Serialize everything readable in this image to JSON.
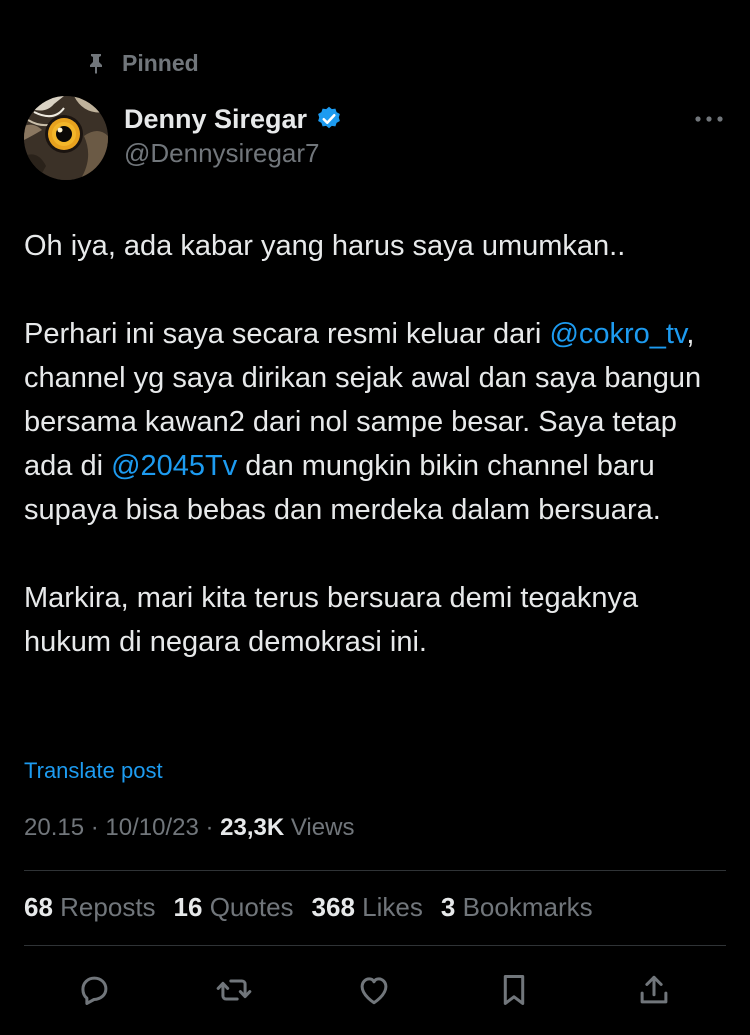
{
  "pinned": {
    "label": "Pinned",
    "icon": "pin-icon"
  },
  "author": {
    "name": "Denny Siregar",
    "handle": "@Dennysiregar7",
    "verified": true,
    "avatar_icon": "owl-eye-avatar"
  },
  "more_icon": "more-horizontal-icon",
  "tweet": {
    "line1": "Oh iya, ada kabar yang harus saya umumkan..",
    "p2_before": "Perhari ini saya secara resmi keluar dari ",
    "mention1": "@cokro_tv",
    "p2_middle": ", channel yg saya dirikan sejak awal dan saya bangun bersama kawan2 dari nol sampe besar. Saya tetap ada di ",
    "mention2": "@2045Tv",
    "p2_after": " dan mungkin bikin channel baru supaya bisa bebas dan merdeka dalam bersuara.",
    "p3": "Markira, mari kita terus bersuara demi tegaknya hukum di negara demokrasi ini."
  },
  "translate_label": "Translate post",
  "meta": {
    "time": "20.15",
    "separator": " · ",
    "date": "10/10/23",
    "views_count": "23,3K",
    "views_label": " Views"
  },
  "stats": [
    {
      "count": "68",
      "label": "Reposts"
    },
    {
      "count": "16",
      "label": "Quotes"
    },
    {
      "count": "368",
      "label": "Likes"
    },
    {
      "count": "3",
      "label": "Bookmarks"
    }
  ],
  "actions": [
    "reply-icon",
    "repost-icon",
    "like-icon",
    "bookmark-icon",
    "share-icon"
  ],
  "colors": {
    "background": "#000000",
    "text_primary": "#e7e9ea",
    "text_secondary": "#71767b",
    "link": "#1d9bf0",
    "verified": "#1d9bf0",
    "divider": "#2f3336"
  }
}
